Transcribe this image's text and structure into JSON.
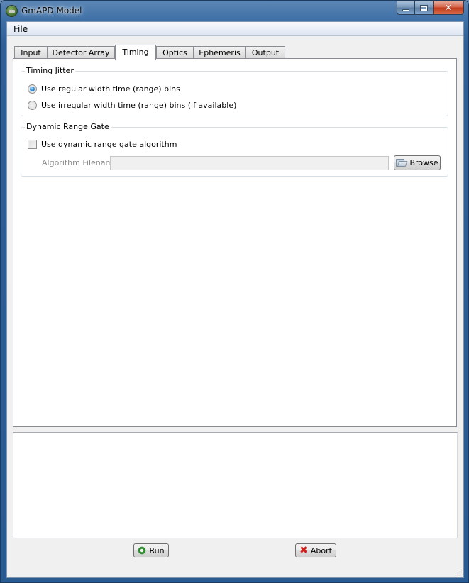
{
  "window": {
    "title": "GmAPD Model",
    "app_icon": "gmapd-app-icon",
    "caption_buttons": [
      "minimize",
      "maximize",
      "close"
    ]
  },
  "menu": {
    "items": [
      {
        "label": "File"
      }
    ]
  },
  "tabs": [
    {
      "label": "Input",
      "active": false
    },
    {
      "label": "Detector Array",
      "active": false
    },
    {
      "label": "Timing",
      "active": true
    },
    {
      "label": "Optics",
      "active": false
    },
    {
      "label": "Ephemeris",
      "active": false
    },
    {
      "label": "Output",
      "active": false
    }
  ],
  "timing_jitter": {
    "title": "Timing Jitter",
    "options": [
      {
        "label": "Use regular width time (range) bins",
        "checked": true
      },
      {
        "label": "Use irregular width time (range) bins (if available)",
        "checked": false
      }
    ]
  },
  "dynamic_range_gate": {
    "title": "Dynamic Range Gate",
    "checkbox_label": "Use dynamic range gate algorithm",
    "checked": false,
    "filename_label": "Algorithm Filename",
    "filename_value": "",
    "browse_label": "Browse"
  },
  "log": {
    "text": ""
  },
  "actions": {
    "run_label": "Run",
    "abort_label": "Abort"
  }
}
